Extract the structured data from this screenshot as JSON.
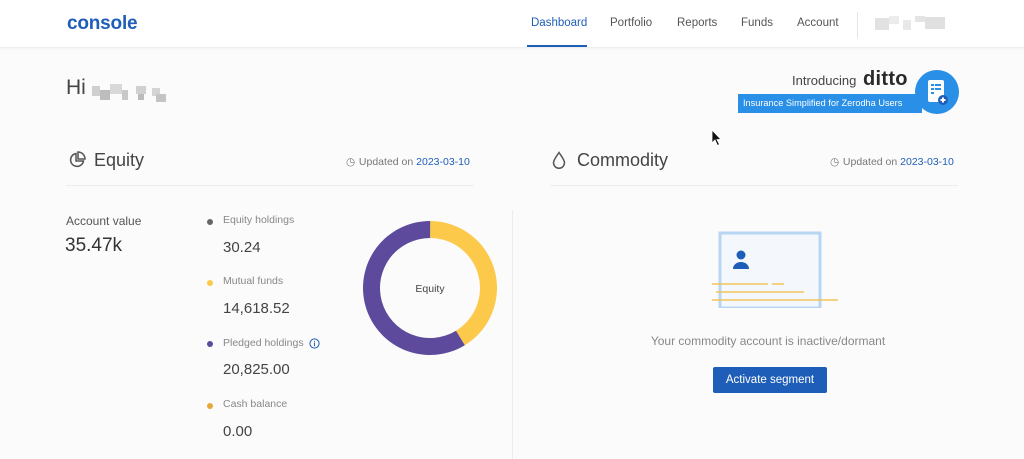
{
  "header": {
    "logo": "console",
    "nav": [
      {
        "label": "Dashboard",
        "active": true
      },
      {
        "label": "Portfolio"
      },
      {
        "label": "Reports"
      },
      {
        "label": "Funds"
      },
      {
        "label": "Account"
      }
    ]
  },
  "greeting": {
    "text": "Hi"
  },
  "banner": {
    "intro": "Introducing",
    "brand": "ditto",
    "tagline": "Insurance Simplified for Zerodha Users"
  },
  "equity": {
    "title": "Equity",
    "updated_label": "Updated on",
    "updated_date": "2023-03-10",
    "account_value_label": "Account value",
    "account_value": "35.47k",
    "breakdown": [
      {
        "label": "Equity holdings",
        "value": "30.24",
        "color": "#666666"
      },
      {
        "label": "Mutual funds",
        "value": "14,618.52",
        "color": "#fcc94a"
      },
      {
        "label": "Pledged holdings",
        "value": "20,825.00",
        "color": "#5d4a9c"
      },
      {
        "label": "Cash balance",
        "value": "0.00",
        "color": "#e6a93a"
      }
    ],
    "donut_center_label": "Equity"
  },
  "chart_data": {
    "type": "pie",
    "categories": [
      "Equity holdings",
      "Mutual funds",
      "Pledged holdings",
      "Cash balance"
    ],
    "values": [
      30.24,
      14618.52,
      20825.0,
      0.0
    ],
    "colors": [
      "#666666",
      "#fcc94a",
      "#5d4a9c",
      "#e6a93a"
    ]
  },
  "commodity": {
    "title": "Commodity",
    "updated_label": "Updated on",
    "updated_date": "2023-03-10",
    "inactive_text": "Your commodity account is inactive/dormant",
    "activate_button": "Activate segment"
  },
  "colors": {
    "accent": "#1f5eb8",
    "banner_blue": "#2a8fe6"
  }
}
